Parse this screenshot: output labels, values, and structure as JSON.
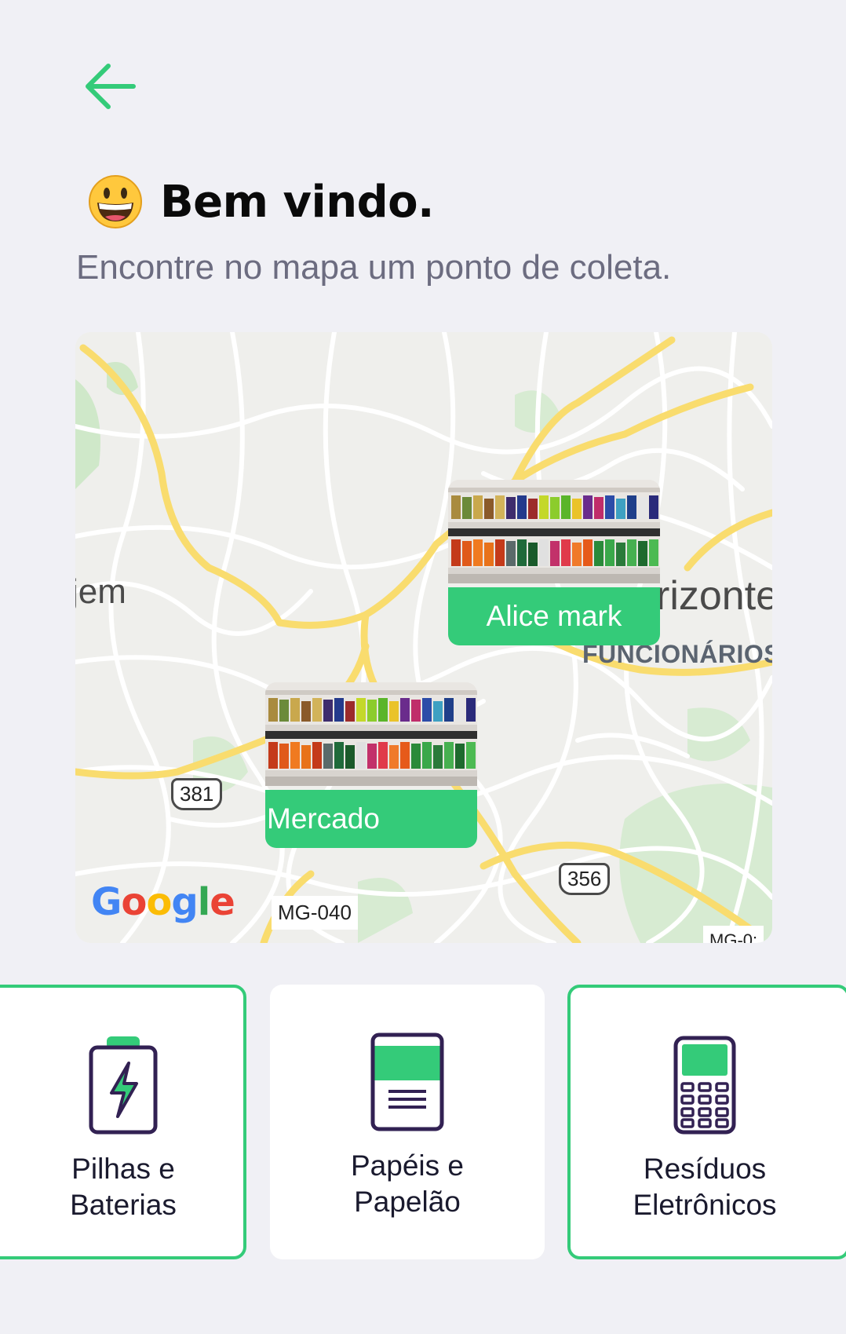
{
  "header": {
    "back_icon": "arrow-left-icon",
    "emoji": "grinning-face-emoji"
  },
  "welcome": {
    "title": "Bem vindo.",
    "subtitle": "Encontre no mapa um ponto de coleta."
  },
  "map": {
    "labels": {
      "city_left": "jem",
      "city_right": "rizonte",
      "district": "FUNCIONÁRIOS"
    },
    "roads": {
      "shield_381": "381",
      "shield_356": "356",
      "mg040": "MG-040",
      "mg0x": "MG-0:"
    },
    "attribution": "Google",
    "markers": [
      {
        "name": "Alice mark",
        "image": "store-shelves-photo"
      },
      {
        "name": "Mercado",
        "image": "store-shelves-photo"
      }
    ]
  },
  "categories": [
    {
      "label_line1": "Pilhas e",
      "label_line2": "Baterias",
      "icon": "battery-icon",
      "selected": true
    },
    {
      "label_line1": "Papéis e",
      "label_line2": "Papelão",
      "icon": "paper-icon",
      "selected": false
    },
    {
      "label_line1": "Resíduos",
      "label_line2": "Eletrônicos",
      "icon": "electronics-icon",
      "selected": true
    }
  ],
  "colors": {
    "accent": "#34cb79",
    "background": "#f0f0f5",
    "text_title": "#0a0a0a",
    "text_subtitle": "#6c6c80",
    "icon_stroke": "#322153"
  }
}
